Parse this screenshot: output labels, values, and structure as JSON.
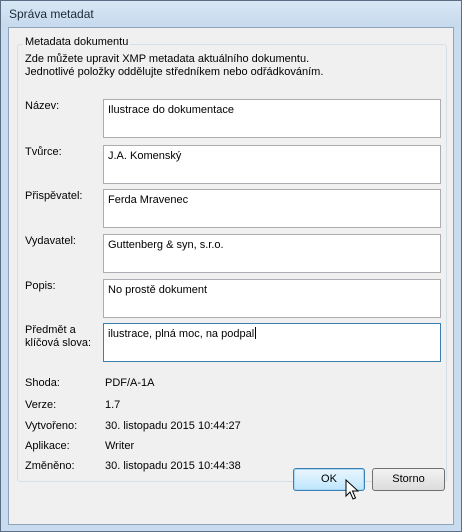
{
  "window": {
    "title": "Správa metadat"
  },
  "group": {
    "legend": "Metadata dokumentu",
    "description_line1": "Zde můžete upravit XMP metadata aktuálního dokumentu.",
    "description_line2": "Jednotlivé položky oddělujte středníkem nebo odřádkováním."
  },
  "fields": [
    {
      "label": "Název:",
      "value": "Ilustrace do dokumentace"
    },
    {
      "label": "Tvůrce:",
      "value": "J.A. Komenský"
    },
    {
      "label": "Přispěvatel:",
      "value": "Ferda Mravenec"
    },
    {
      "label": "Vydavatel:",
      "value": "Guttenberg & syn, s.r.o."
    },
    {
      "label": "Popis:",
      "value": "No prostě dokument"
    },
    {
      "label_line1": "Předmět a",
      "label_line2": "klíčová slova:",
      "value": "ilustrace, plná moc, na podpal"
    }
  ],
  "info": [
    {
      "label": "Shoda:",
      "value": "PDF/A-1A"
    },
    {
      "label": "Verze:",
      "value": "1.7"
    },
    {
      "label": "Vytvořeno:",
      "value": "30. listopadu 2015 10:44:27"
    },
    {
      "label": "Aplikace:",
      "value": "Writer"
    },
    {
      "label": "Změněno:",
      "value": "30. listopadu 2015 10:44:38"
    }
  ],
  "buttons": {
    "ok": "OK",
    "cancel": "Storno"
  }
}
